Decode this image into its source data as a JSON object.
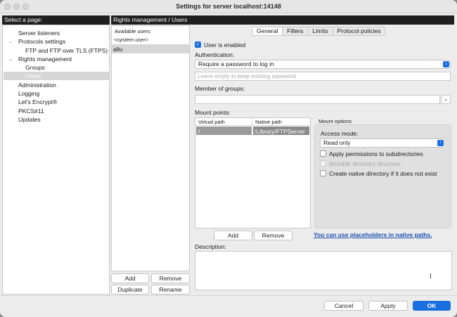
{
  "window": {
    "title": "Settings for server localhost:14148"
  },
  "left": {
    "header": "Select a page:",
    "items": [
      {
        "label": "Server listeners"
      },
      {
        "label": "Protocols settings"
      },
      {
        "label": "FTP and FTP over TLS (FTPS)"
      },
      {
        "label": "Rights management"
      },
      {
        "label": "Groups"
      },
      {
        "label": "Users"
      },
      {
        "label": "Administration"
      },
      {
        "label": "Logging"
      },
      {
        "label": "Let's Encrypt®"
      },
      {
        "label": "PKCS#11"
      },
      {
        "label": "Updates"
      }
    ]
  },
  "main": {
    "header": "Rights management / Users"
  },
  "users": {
    "header": "Available users",
    "system_user": "<system user>",
    "selected_user": "allu",
    "add": "Add",
    "remove": "Remove",
    "duplicate": "Duplicate",
    "rename": "Rename"
  },
  "tabs": [
    "General",
    "Filters",
    "Limits",
    "Protocol policies"
  ],
  "general": {
    "user_enabled": "User is enabled",
    "auth_label": "Authentication:",
    "auth_value": "Require a password to log in",
    "password_placeholder": "Leave empty to keep existing password",
    "member_label": "Member of groups:",
    "mount_label": "Mount points:",
    "col_virtual": "Virtual path",
    "col_native": "Native path",
    "mount_rows": [
      {
        "virtual": "/",
        "native": "/Library/FTPServer"
      }
    ],
    "mount_add": "Add",
    "mount_remove": "Remove",
    "mount_options": {
      "title": "Mount options",
      "access_label": "Access mode:",
      "access_value": "Read only",
      "apply_perms": "Apply permissions to subdirectories",
      "writable": "Writable directory structure",
      "create_native": "Create native directory if it does not exist"
    },
    "placeholders_link": "You can use placeholders in native paths.",
    "description_label": "Description:"
  },
  "footer": {
    "cancel": "Cancel",
    "apply": "Apply",
    "ok": "OK"
  },
  "colors": {
    "accent": "#1a6fe0",
    "header_bg": "#1f1f1f",
    "selection": "#d6d6d6"
  }
}
